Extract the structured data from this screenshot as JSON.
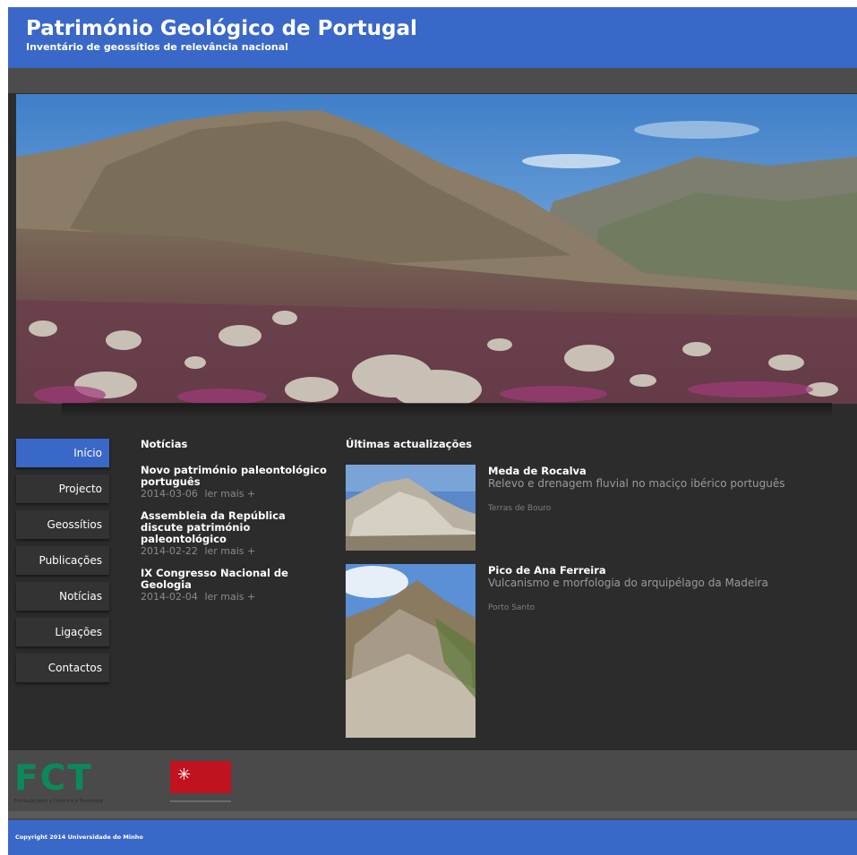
{
  "header": {
    "title": "Património Geológico de Portugal",
    "subtitle": "Inventário de geossítios de relevância nacional"
  },
  "nav": {
    "items": [
      {
        "label": "Início",
        "active": true
      },
      {
        "label": "Projecto",
        "active": false
      },
      {
        "label": "Geossítios",
        "active": false
      },
      {
        "label": "Publicações",
        "active": false
      },
      {
        "label": "Notícias",
        "active": false
      },
      {
        "label": "Ligações",
        "active": false
      },
      {
        "label": "Contactos",
        "active": false
      }
    ]
  },
  "news": {
    "heading": "Notícias",
    "items": [
      {
        "title": "Novo património paleontológico português",
        "date": "2014-03-06",
        "more": "ler mais +"
      },
      {
        "title": "Assembleia da República discute património paleontológico",
        "date": "2014-02-22",
        "more": "ler mais +"
      },
      {
        "title": "IX Congresso Nacional de Geologia",
        "date": "2014-02-04",
        "more": "ler mais +"
      }
    ]
  },
  "updates": {
    "heading": "Últimas actualizações",
    "items": [
      {
        "title": "Meda de Rocalva",
        "description": "Relevo e drenagem fluvial no maciço ibérico português",
        "location": "Terras de Bouro"
      },
      {
        "title": "Pico de Ana Ferreira",
        "description": "Vulcanismo e morfologia do arquipélago da Madeira",
        "location": "Porto Santo"
      }
    ]
  },
  "footer": {
    "fct_letters": "FCT",
    "fct_caption": "Fundação para a Ciência e a Tecnologia",
    "copyright": "Copyright 2014 Universidade do Minho"
  },
  "colors": {
    "brand_blue": "#3a68c8",
    "dark_bg": "#2c2c2c",
    "fct_green": "#0a8a5a",
    "uminho_red": "#c1121f"
  }
}
